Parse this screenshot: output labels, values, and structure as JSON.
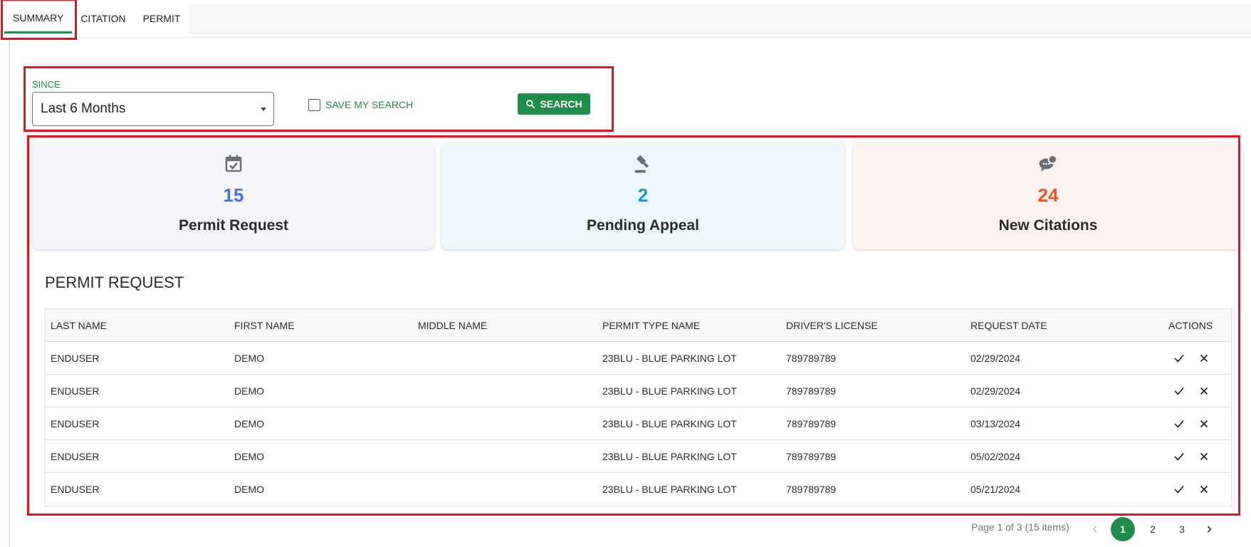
{
  "tabs": [
    {
      "label": "SUMMARY",
      "active": true
    },
    {
      "label": "CITATION",
      "active": false
    },
    {
      "label": "PERMIT",
      "active": false
    }
  ],
  "filter": {
    "since_label": "SINCE",
    "since_value": "Last 6 Months",
    "save_search_label": "SAVE MY SEARCH",
    "save_search_checked": false,
    "search_button": "SEARCH"
  },
  "cards": [
    {
      "icon": "calendar-check-icon",
      "count": "15",
      "title": "Permit Request",
      "count_color": "#4a6fe0",
      "bg": "#f3f5f8"
    },
    {
      "icon": "gavel-icon",
      "count": "2",
      "title": "Pending Appeal",
      "count_color": "#1a9ac9",
      "bg": "#edf8fc"
    },
    {
      "icon": "chat-bubbles-icon",
      "count": "24",
      "title": "New Citations",
      "count_color": "#f2541b",
      "bg": "#fef3f0"
    }
  ],
  "permit_section": {
    "title": "PERMIT REQUEST",
    "columns": [
      "LAST NAME",
      "FIRST NAME",
      "MIDDLE NAME",
      "PERMIT TYPE NAME",
      "DRIVER'S LICENSE",
      "REQUEST DATE",
      "ACTIONS"
    ],
    "rows": [
      [
        "ENDUSER",
        "DEMO",
        "",
        "23BLU - BLUE PARKING LOT",
        "789789789",
        "02/29/2024"
      ],
      [
        "ENDUSER",
        "DEMO",
        "",
        "23BLU - BLUE PARKING LOT",
        "789789789",
        "02/29/2024"
      ],
      [
        "ENDUSER",
        "DEMO",
        "",
        "23BLU - BLUE PARKING LOT",
        "789789789",
        "03/13/2024"
      ],
      [
        "ENDUSER",
        "DEMO",
        "",
        "23BLU - BLUE PARKING LOT",
        "789789789",
        "05/02/2024"
      ],
      [
        "ENDUSER",
        "DEMO",
        "",
        "23BLU - BLUE PARKING LOT",
        "789789789",
        "05/21/2024"
      ]
    ]
  },
  "pager": {
    "info": "Page 1 of 3 (15 items)",
    "pages": [
      "1",
      "2",
      "3"
    ],
    "current": "1"
  },
  "colors": {
    "accent": "#1e8c4a",
    "highlight": "#e8121c"
  }
}
